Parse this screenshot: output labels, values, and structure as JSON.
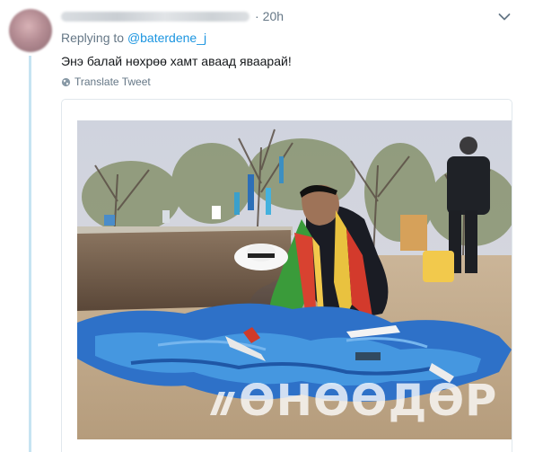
{
  "tweet": {
    "timestamp": "20h",
    "separator": "·",
    "reply_prefix": "Replying to",
    "reply_handle": "@baterdene_j",
    "text": "Энэ балай нөхрөө хамт аваад яваарай!",
    "translate_label": "Translate Tweet",
    "watermark": "ӨНӨӨДӨР"
  },
  "colors": {
    "link": "#1b95e0",
    "secondary_text": "#657786",
    "thread_line": "#c6e4f2"
  },
  "icons": {
    "translate": "globe-icon",
    "menu": "chevron-down-icon"
  }
}
